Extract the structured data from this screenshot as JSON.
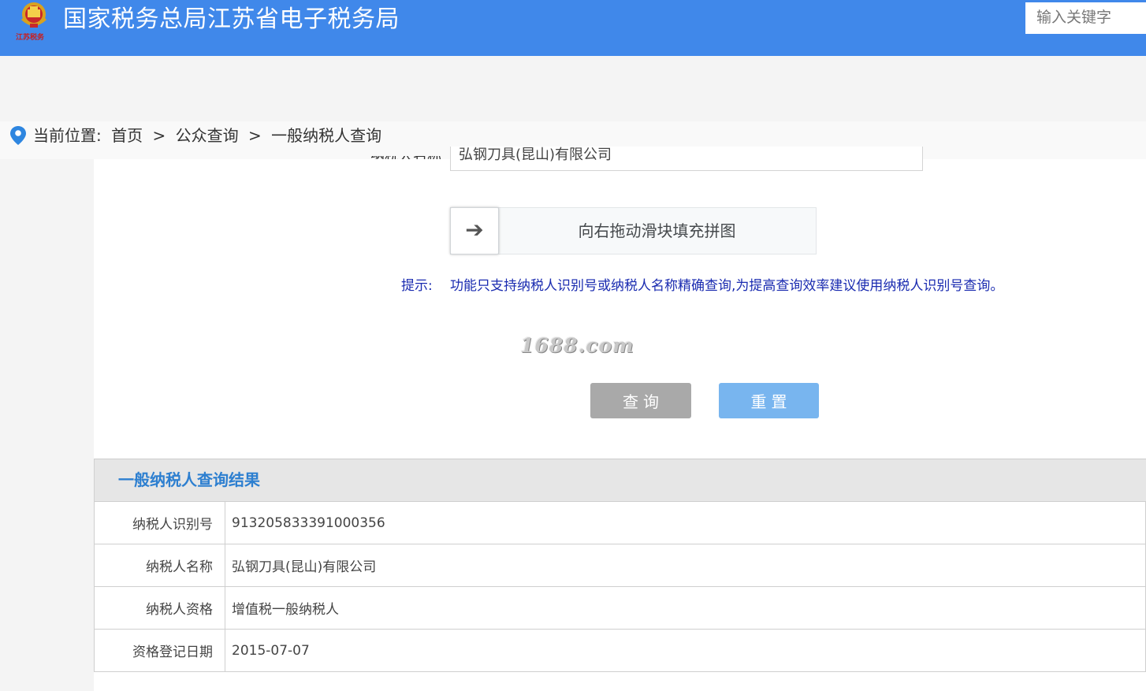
{
  "header": {
    "title": "国家税务总局江苏省电子税务局",
    "logo_text": "江苏税务",
    "search_placeholder": "输入关键字"
  },
  "breadcrumb": {
    "label": "当前位置:",
    "items": [
      "首页",
      "公众查询",
      "一般纳税人查询"
    ],
    "separator": ">"
  },
  "form": {
    "name_label_partial": "纳税人名称",
    "name_value_partial": "弘钢刀具(昆山)有限公司",
    "slider_text": "向右拖动滑块填充拼图",
    "slider_arrow": "➔",
    "tip_label": "提示:",
    "tip_text": "功能只支持纳税人识别号或纳税人名称精确查询,为提高查询效率建议使用纳税人识别号查询。",
    "query_button": "查询",
    "reset_button": "重置"
  },
  "watermark": "1688.com",
  "result": {
    "title": "一般纳税人查询结果",
    "rows": [
      {
        "label": "纳税人识别号",
        "value": "913205833391000356"
      },
      {
        "label": "纳税人名称",
        "value": "弘钢刀具(昆山)有限公司"
      },
      {
        "label": "纳税人资格",
        "value": "增值税一般纳税人"
      },
      {
        "label": "资格登记日期",
        "value": "2015-07-07"
      }
    ]
  },
  "colors": {
    "header_bg": "#4088ea",
    "result_title": "#2d7fd0",
    "tip_text": "#1a2bb0",
    "query_button": "#a9a9a9",
    "reset_button": "#78b5ef"
  }
}
